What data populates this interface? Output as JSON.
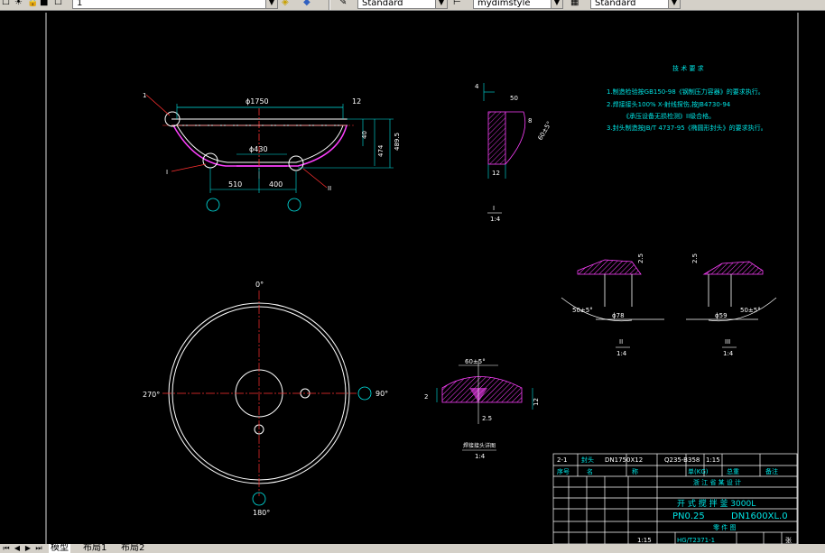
{
  "toolbar": {
    "layer_name": "1",
    "text_style": "Standard",
    "dim_style": "mydimstyle",
    "table_style": "Standard",
    "icons": [
      "layer-state-icon",
      "sun-icon",
      "lock-icon",
      "layer-color-icon",
      "match-layer-icon",
      "layer-previous-icon",
      "text-style-icon",
      "dim-style-icon",
      "table-style-icon"
    ]
  },
  "tabs": {
    "model": "模型",
    "layout1": "布局1",
    "layout2": "布局2"
  },
  "drawing": {
    "tech_req_title": "技 术 要 求",
    "tech_req": [
      "1.制造检验按GB150-98《钢制压力容器》的要求执行。",
      "2.焊接接头100% X-射线探伤,按JB4730-94",
      "《承压设备无损检测》II级合格。",
      "3.封头制造按JB/T 4737-95《椭圆形封头》的要求执行。"
    ],
    "head": {
      "dia_top": "ϕ1750",
      "thk_right": "12",
      "h40": "40",
      "h474": "474",
      "h4895": "489.5",
      "dia_mid": "ϕ430",
      "d510": "510",
      "d400": "400",
      "label_1": "1",
      "label_left": "I",
      "label_right": "II"
    },
    "detail_I": {
      "d4": "4",
      "d50": "50",
      "d8": "8",
      "angle": "60±5°",
      "thk": "12",
      "label_top": "I",
      "label_bot": "1:4"
    },
    "detail_II": {
      "d25": "2.5",
      "angle": "50±5°",
      "dia": "ϕ78",
      "label_top": "II",
      "label_bot": "1:4"
    },
    "detail_III": {
      "d25": "2.5",
      "angle": "50±5°",
      "dia": "ϕ59",
      "label_top": "III",
      "label_bot": "1:4"
    },
    "detail_weld": {
      "angle": "60±5°",
      "d2": "2",
      "thk": "12",
      "d25": "2.5",
      "label_top": "焊接接头详图",
      "label_bot": "1:4"
    },
    "plan": {
      "a0": "0°",
      "a90": "90°",
      "a180": "180°",
      "a270": "270°"
    },
    "title_block": {
      "row1": [
        "2-1",
        "封头",
        "DN1750X12",
        "Q235-B",
        "358",
        "1:15"
      ],
      "row2": [
        "序号",
        "名",
        "称",
        "单(KG)",
        "总重",
        "备注"
      ],
      "company": "浙 江 省 某 设 计",
      "product": "开 式 搅 拌 釜 3000L",
      "pn": "PN0.25",
      "dn": "DN1600XL.0",
      "part": "零 件 图",
      "scale": "1:15",
      "std": "HG/T2371-1",
      "sheet": "张"
    }
  }
}
